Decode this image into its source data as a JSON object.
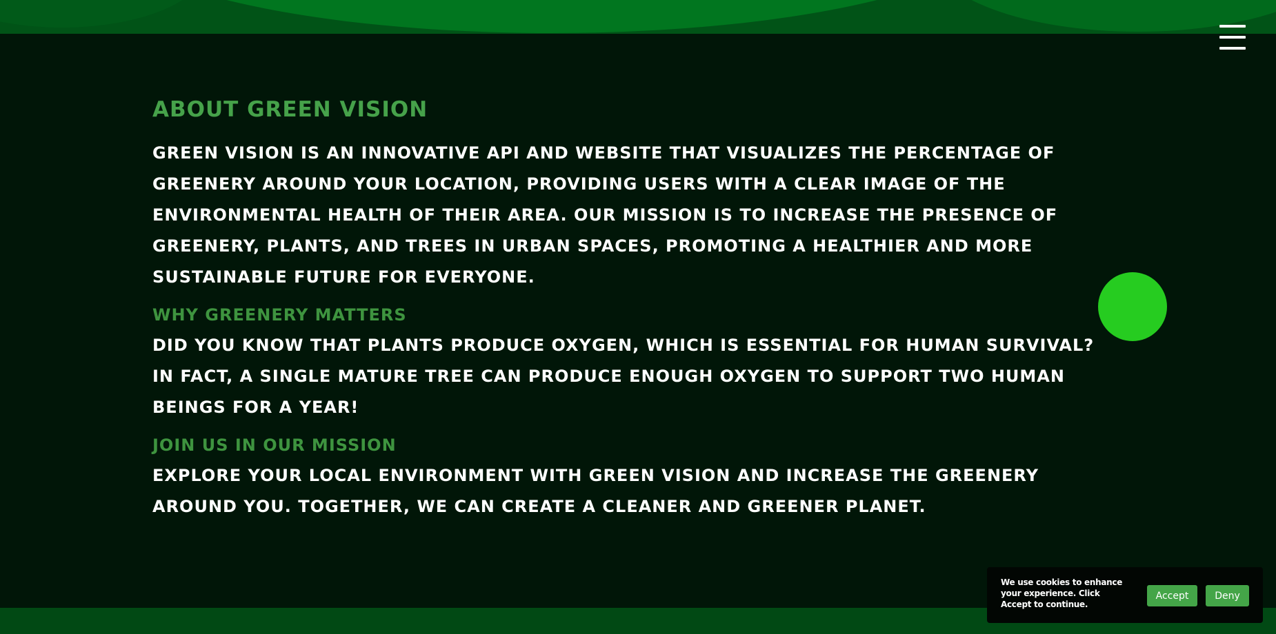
{
  "menu": {
    "icon": "hamburger-menu-icon"
  },
  "about": {
    "title": "ABOUT GREEN VISION",
    "body": "GREEN VISION IS AN INNOVATIVE API AND WEBSITE THAT VISUALIZES THE PERCENTAGE OF GREENERY AROUND YOUR LOCATION, PROVIDING USERS WITH A CLEAR IMAGE OF THE ENVIRONMENTAL HEALTH OF THEIR AREA. OUR MISSION IS TO INCREASE THE PRESENCE OF GREENERY, PLANTS, AND TREES IN URBAN SPACES, PROMOTING A HEALTHIER AND MORE SUSTAINABLE FUTURE FOR EVERYONE."
  },
  "why": {
    "title": "WHY GREENERY MATTERS",
    "body": "DID YOU KNOW THAT PLANTS PRODUCE OXYGEN, WHICH IS ESSENTIAL FOR HUMAN SURVIVAL? IN FACT, A SINGLE MATURE TREE CAN PRODUCE ENOUGH OXYGEN TO SUPPORT TWO HUMAN BEINGS FOR A YEAR!"
  },
  "join": {
    "title": "JOIN US IN OUR MISSION",
    "body": "EXPLORE YOUR LOCAL ENVIRONMENT WITH GREEN VISION AND INCREASE THE GREENERY AROUND YOU. TOGETHER, WE CAN CREATE A CLEANER AND GREENER PLANET."
  },
  "cookie": {
    "text": "We use cookies to enhance your experience. Click Accept to continue.",
    "accept_label": "Accept",
    "deny_label": "Deny"
  },
  "colors": {
    "background": "#011608",
    "accent_green": "#46a24a",
    "dot_green": "#26cc20",
    "button_green": "#44a548"
  }
}
